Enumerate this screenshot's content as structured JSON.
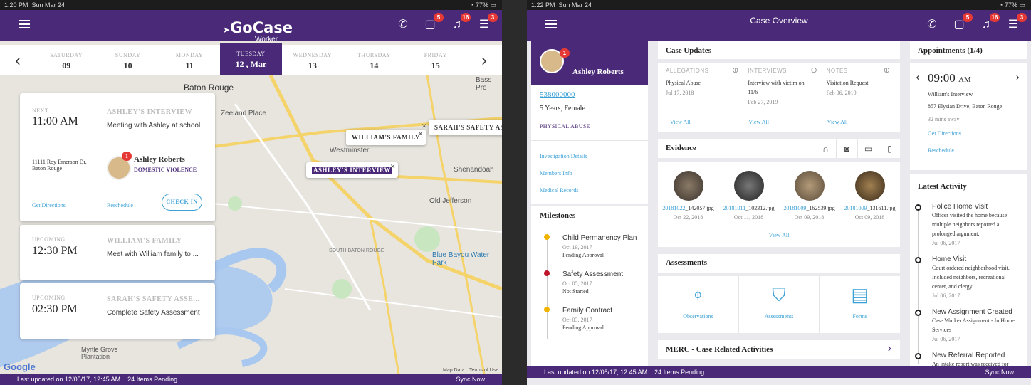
{
  "left": {
    "status": {
      "time": "1:20 PM",
      "date": "Sun Mar 24",
      "battery": "77%"
    },
    "logo": {
      "name": "GoCase",
      "sub": "Worker"
    },
    "badges": {
      "chat": "5",
      "bell": "16",
      "list": "3"
    },
    "days": [
      {
        "name": "SATURDAY",
        "num": "09"
      },
      {
        "name": "SUNDAY",
        "num": "10"
      },
      {
        "name": "MONDAY",
        "num": "11"
      },
      {
        "name": "TUESDAY",
        "num": "12 , Mar"
      },
      {
        "name": "WEDNESDAY",
        "num": "13"
      },
      {
        "name": "THURSDAY",
        "num": "14"
      },
      {
        "name": "FRIDAY",
        "num": "15"
      }
    ],
    "map_labels": {
      "baton_rouge": "Baton Rouge",
      "zeeland": "Zeeland Place",
      "westminster": "Westminster",
      "shenandoah": "Shenandoah",
      "old_jefferson": "Old Jefferson",
      "south_br": "SOUTH BATON ROUGE",
      "blue_bayou": "Blue Bayou Water Park",
      "myrtle": "Myrtle Grove Plantation",
      "bass_pro": "Bass Pro",
      "google": "Google",
      "map_data": "Map Data",
      "terms": "Terms of Use"
    },
    "popups": {
      "william": "WILLIAM'S FAMILY",
      "ashley": "ASHLEY'S INTERVIEW",
      "sarah": "SARAH'S SAFETY AS"
    },
    "cards": [
      {
        "label": "NEXT",
        "time": "11:00 AM",
        "title": "ASHLEY'S INTERVIEW",
        "sub": "Meeting with Ashley at school",
        "addr1": "11111 Roy Emerson Dr,",
        "addr2": "Baton Rouge",
        "name": "Ashley Roberts",
        "tag": "DOMESTIC VIOLENCE",
        "avatar_badge": "1",
        "dir": "Get Directions",
        "resched": "Reschedule",
        "checkin": "CHECK IN"
      },
      {
        "label": "UPCOMING",
        "time": "12:30 PM",
        "title": "WILLIAM'S FAMILY",
        "sub": "Meet with William family to ..."
      },
      {
        "label": "UPCOMING",
        "time": "02:30 PM",
        "title": "SARAH'S SAFETY ASSE...",
        "sub": "Complete Safety Assessment"
      }
    ],
    "bottom": {
      "updated": "Last updated on 12/05/17, 12:45 AM",
      "pending": "24 Items Pending",
      "sync": "Sync Now"
    }
  },
  "right": {
    "status": {
      "time": "1:22 PM",
      "date": "Sun Mar 24",
      "battery": "77%"
    },
    "title": "Case Overview",
    "badges": {
      "chat": "5",
      "bell": "16",
      "list": "3"
    },
    "profile": {
      "name": "Ashley Roberts",
      "badge": "1",
      "case_id": "538000000",
      "age": "5 Years, Female",
      "type": "PHYSICAL ABUSE"
    },
    "links": [
      "Investigation Details",
      "Members Info",
      "Medical Records"
    ],
    "milestones": {
      "title": "Milestones",
      "items": [
        {
          "name": "Child Permanency Plan",
          "date": "Oct 19, 2017",
          "status": "Pending Approval",
          "color": "#f0b400"
        },
        {
          "name": "Safety Assessment",
          "date": "Oct 05, 2017",
          "status": "Not Started",
          "color": "#c0142a"
        },
        {
          "name": "Family Contract",
          "date": "Oct 03, 2017",
          "status": "Pending Approval",
          "color": "#f0b400"
        }
      ]
    },
    "case_updates": {
      "title": "Case Updates",
      "cols": [
        {
          "head": "ALLEGATIONS",
          "line1": "Physical Abuse",
          "line2": "",
          "date": "Jul 17, 2018",
          "view": "View All"
        },
        {
          "head": "INTERVIEWS",
          "line1": "Interview with victim on",
          "line2": "11/6",
          "date": "Feb 27, 2019",
          "view": "View All"
        },
        {
          "head": "NOTES",
          "line1": "Visitation Request",
          "line2": "",
          "date": "Feb 06, 2019",
          "view": "View All"
        }
      ]
    },
    "evidence": {
      "title": "Evidence",
      "items": [
        {
          "link": "20181022",
          "rest": "_142057.jpg",
          "date": "Oct 22, 2018"
        },
        {
          "link": "20181011",
          "rest": "_102312.jpg",
          "date": "Oct 11, 2018"
        },
        {
          "link": "20181009",
          "rest": "_162539.jpg",
          "date": "Oct 09, 2018"
        },
        {
          "link": "20181009",
          "rest": "_131611.jpg",
          "date": "Oct 09, 2018"
        }
      ],
      "view": "View All"
    },
    "assessments": {
      "title": "Assessments",
      "items": [
        "Observations",
        "Assessments",
        "Forms"
      ]
    },
    "merc": "MERC - Case Related Activities",
    "appointments": {
      "title": "Appointments (1/4)",
      "time": "09:00",
      "ampm": "AM",
      "desc": "William's Interview",
      "addr": "857 Elysian Drive, Baton Rouge",
      "away": "32 mins away",
      "dir": "Get Directions",
      "resched": "Reschedule"
    },
    "activity": {
      "title": "Latest Activity",
      "items": [
        {
          "t": "Police Home Visit",
          "d": "Officer visited the home because multiple neighbors reported a prolonged argument.",
          "date": "Jul 06, 2017"
        },
        {
          "t": "Home Visit",
          "d": "Court ordered neighborhood visit. Included neighbors, recreational center, and clergy.",
          "date": "Jul 06, 2017"
        },
        {
          "t": "New Assignment Created",
          "d": "Case Worker Assignment - In Home Services",
          "date": "Jul 06, 2017"
        },
        {
          "t": "New Referral Reported",
          "d": "An intake report was received for",
          "date": ""
        }
      ]
    },
    "bottom": {
      "updated": "Last updated on 12/05/17, 12:45 AM",
      "pending": "24 Items Pending",
      "sync": "Sync Now"
    }
  }
}
